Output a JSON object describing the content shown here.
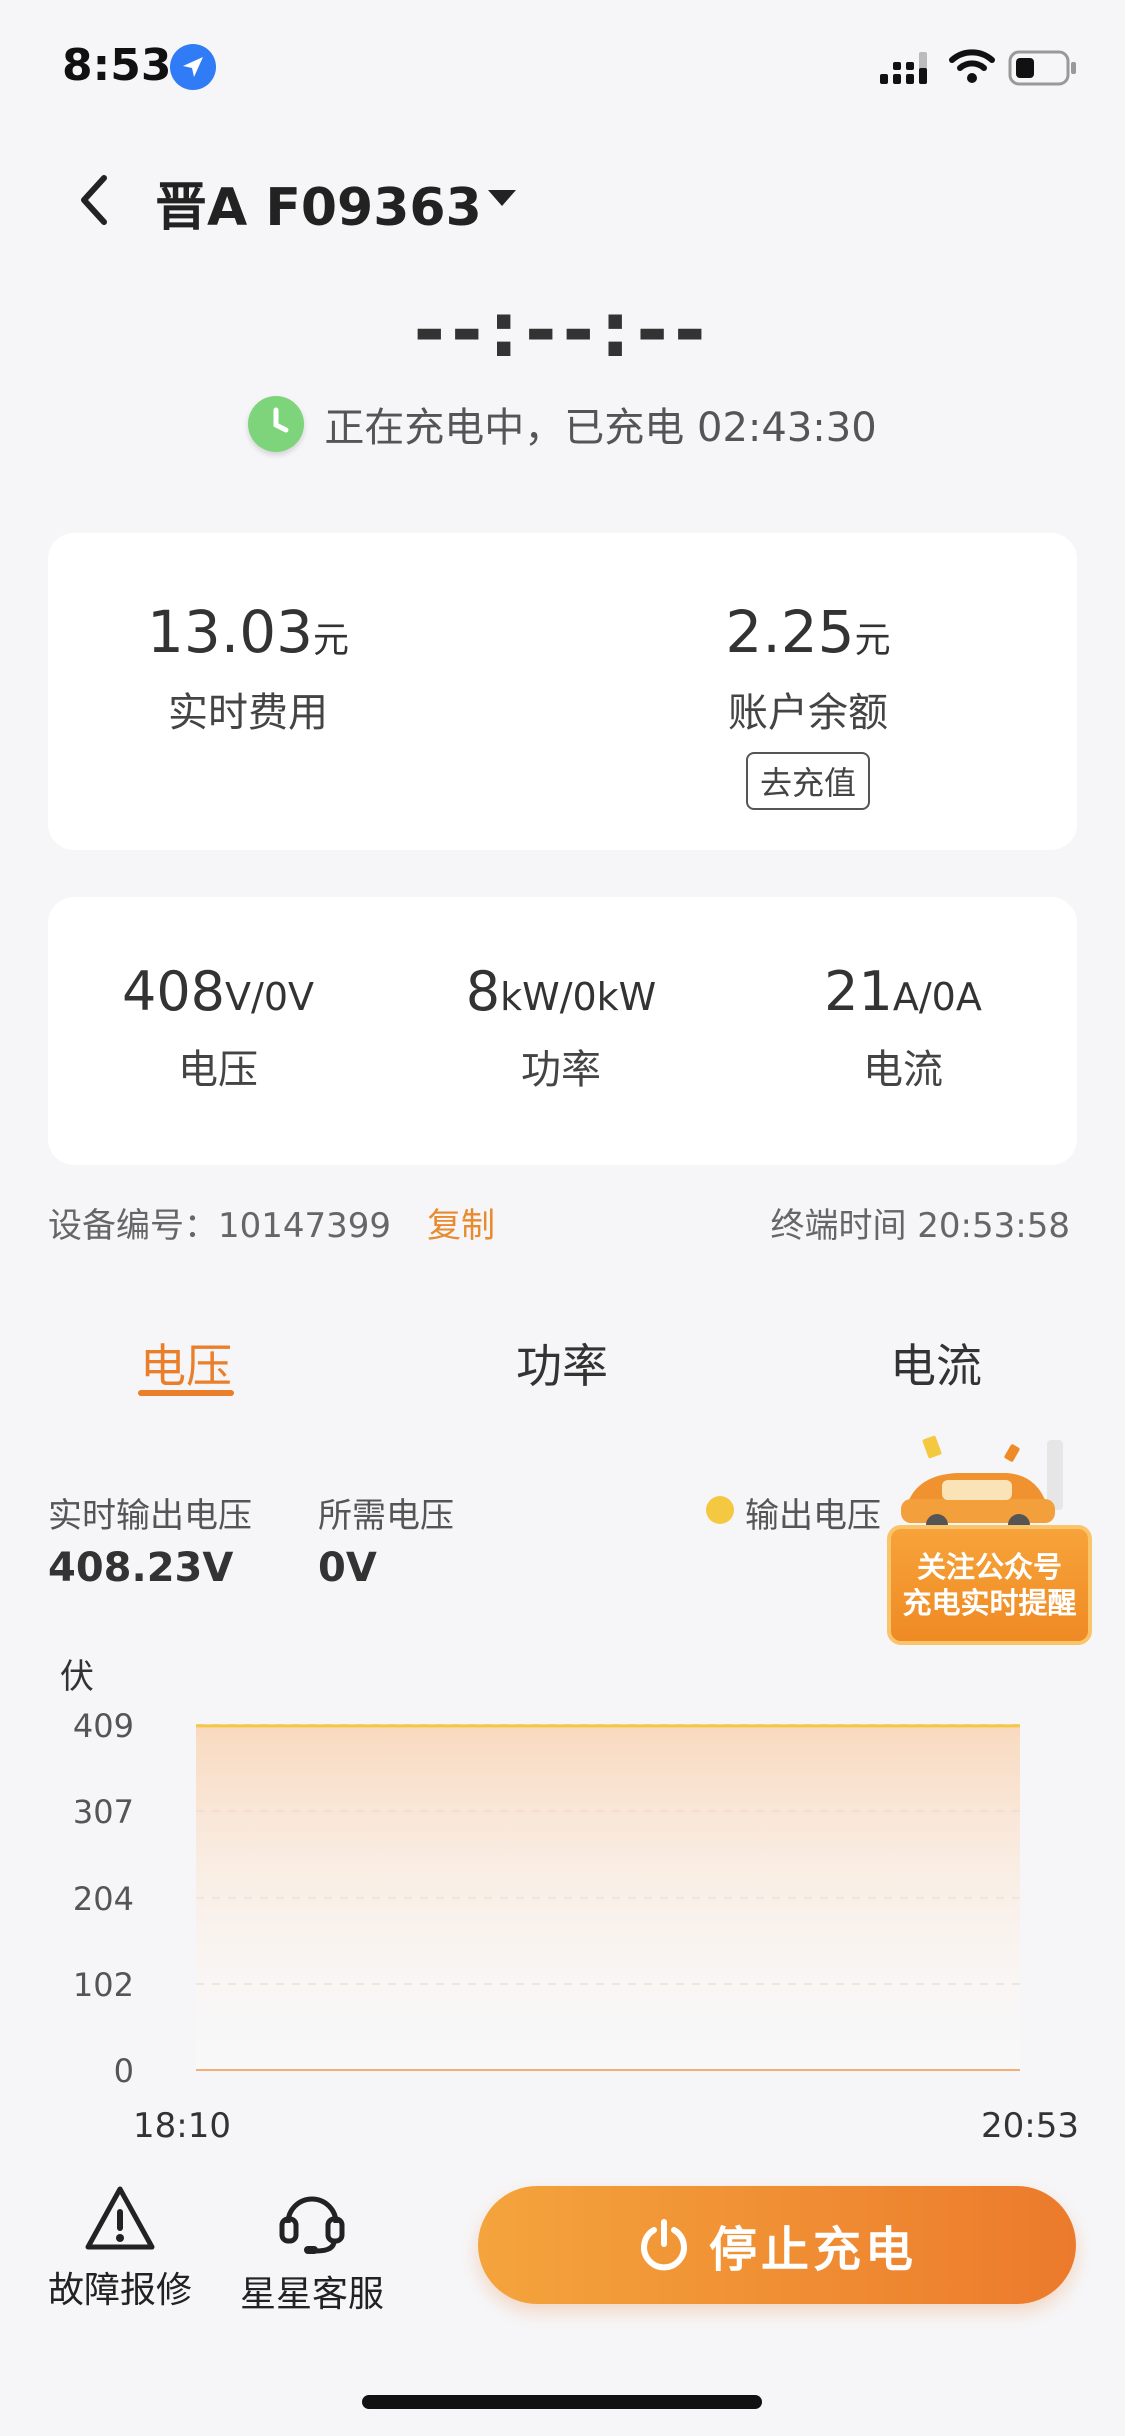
{
  "status_bar": {
    "time": "8:53"
  },
  "header": {
    "plate": "晋A F09363"
  },
  "countdown": "--:--:--",
  "charge_status": "正在充电中，已充电 02:43:30",
  "fee_card": {
    "realtime_cost_value": "13.03",
    "realtime_cost_unit": "元",
    "realtime_cost_label": "实时费用",
    "balance_value": "2.25",
    "balance_unit": "元",
    "balance_label": "账户余额",
    "recharge_label": "去充值"
  },
  "electric_card": {
    "voltage_value": "408",
    "voltage_unit": "V/0V",
    "voltage_label": "电压",
    "power_value": "8",
    "power_unit": "kW/0kW",
    "power_label": "功率",
    "current_value": "21",
    "current_unit": "A/0A",
    "current_label": "电流"
  },
  "device": {
    "id_label": "设备编号：",
    "id_value": "10147399",
    "copy_label": "复制",
    "terminal_time_label": "终端时间",
    "terminal_time_value": "20:53:58"
  },
  "tabs": [
    {
      "label": "电压",
      "active": true
    },
    {
      "label": "功率",
      "active": false
    },
    {
      "label": "电流",
      "active": false
    }
  ],
  "metrics": {
    "realtime_output_label": "实时输出电压",
    "realtime_output_value": "408.23V",
    "required_label": "所需电压",
    "required_value": "0V",
    "legend_label": "输出电压"
  },
  "promo": {
    "line1": "关注公众号",
    "line2": "充电实时提醒"
  },
  "colors": {
    "accent": "#ea7f2b",
    "legend": "#f5c842",
    "status_green": "#7ed47a"
  },
  "chart_data": {
    "type": "area",
    "ylabel": "伏",
    "y_ticks": [
      "409",
      "307",
      "204",
      "102",
      "0"
    ],
    "ylim": [
      0,
      409
    ],
    "x_labels": [
      "18:10",
      "20:53"
    ],
    "series": [
      {
        "name": "输出电压",
        "x": [
          "18:10",
          "20:53"
        ],
        "values": [
          408,
          408
        ]
      }
    ],
    "grid": true
  },
  "bottom": {
    "fault_label": "故障报修",
    "service_label": "星星客服",
    "stop_label": "停止充电"
  }
}
